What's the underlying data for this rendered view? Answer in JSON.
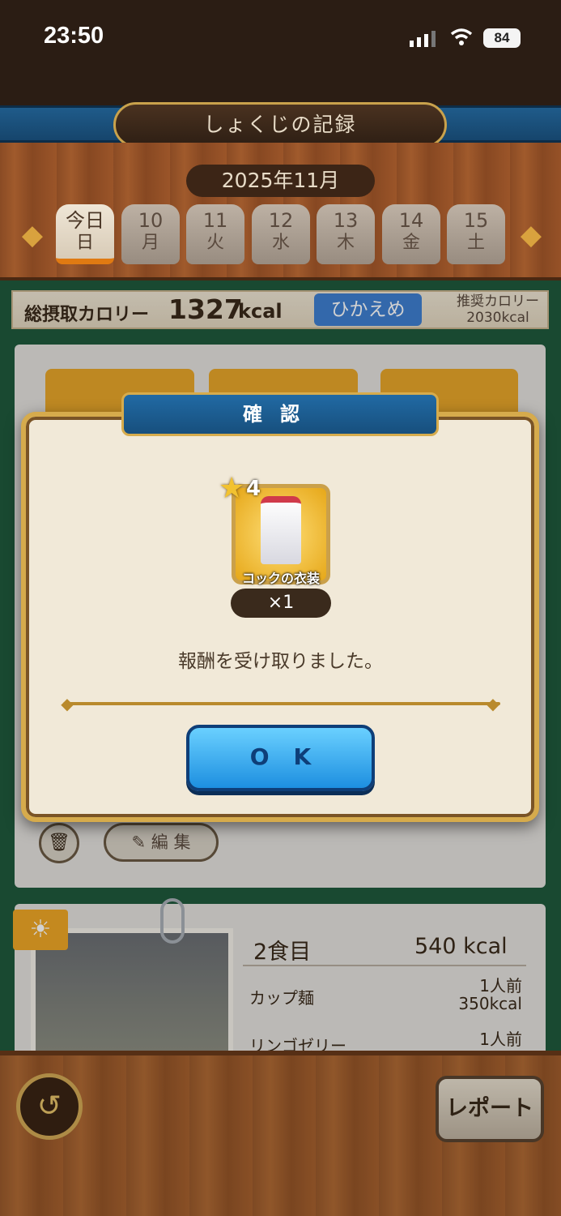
{
  "status_bar": {
    "time": "23:50",
    "battery": "84"
  },
  "header": {
    "title": "しょくじの記録",
    "month": "2025年11月"
  },
  "days": [
    {
      "num": "今日",
      "dow": "日",
      "today": true
    },
    {
      "num": "10",
      "dow": "月"
    },
    {
      "num": "11",
      "dow": "火"
    },
    {
      "num": "12",
      "dow": "水"
    },
    {
      "num": "13",
      "dow": "木"
    },
    {
      "num": "14",
      "dow": "金"
    },
    {
      "num": "15",
      "dow": "土"
    }
  ],
  "calories": {
    "label": "総摂取カロリー",
    "value": "1327",
    "unit": "kcal",
    "mode": "ひかえめ",
    "recommended_label": "推奨カロリー",
    "recommended_value": "2030kcal"
  },
  "card": {
    "edit_label": "編 集"
  },
  "meal": {
    "title": "2食目",
    "kcal": "540 kcal",
    "items": [
      {
        "name": "カップ麺",
        "qty": "1人前",
        "kcal": "350kcal"
      },
      {
        "name": "リンゴゼリー",
        "qty": "1人前"
      }
    ]
  },
  "footer": {
    "report_label": "レポート"
  },
  "dialog": {
    "title": "確認",
    "reward_rarity": "4",
    "reward_name": "コックの衣装",
    "reward_qty": "×1",
    "message": "報酬を受け取りました。",
    "ok_label": "OK"
  }
}
